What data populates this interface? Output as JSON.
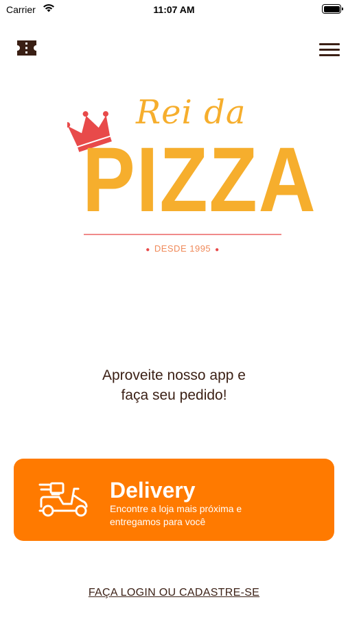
{
  "status_bar": {
    "carrier": "Carrier",
    "time": "11:07 AM",
    "icons": [
      "wifi-icon",
      "battery-icon"
    ]
  },
  "top_bar": {
    "left_icon": "ticket-icon",
    "right_icon": "hamburger-menu-icon"
  },
  "logo": {
    "line1": "Rei da",
    "line2": "PIZZA",
    "since": "DESDE 1995",
    "crown_icon": "crown-icon",
    "colors": {
      "primary": "#f6ae2d",
      "crown": "#e84a4a",
      "rule": "#f08a8a"
    }
  },
  "tagline": {
    "line1": "Aproveite nosso app e",
    "line2": "faça seu pedido!"
  },
  "delivery_card": {
    "title": "Delivery",
    "description": "Encontre a loja mais próxima e entregamos para você",
    "icon": "scooter-icon",
    "color": "#ff7a00"
  },
  "login_link": "FAÇA LOGIN OU CADASTRE-SE"
}
